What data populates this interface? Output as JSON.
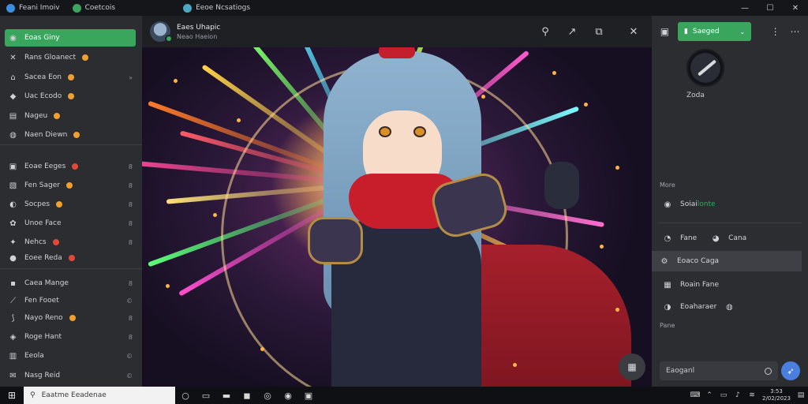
{
  "window": {
    "tabs": [
      {
        "label": "Feani Imoiv",
        "color": "#3b8fe0"
      },
      {
        "label": "Coetcois",
        "color": "#3aa55c"
      },
      {
        "label": "Eeoe Ncsatiogs",
        "color": "#4aa8c0"
      }
    ],
    "controls": {
      "minimize": "—",
      "maximize": "☐",
      "close": "✕"
    }
  },
  "sidebar": {
    "items": [
      {
        "label": "Eoas Giny",
        "icon": "app-icon",
        "glyph": "◉",
        "active": true,
        "badge": "",
        "count": ""
      },
      {
        "label": "Rans Gloanect",
        "icon": "close-icon",
        "glyph": "✕",
        "badge": "orange",
        "count": ""
      },
      {
        "label": "Sacea Eon",
        "icon": "home-icon",
        "glyph": "⌂",
        "badge": "orange",
        "count": "»"
      },
      {
        "label": "Uac Ecodo",
        "icon": "shield-icon",
        "glyph": "◆",
        "badge": "orange",
        "count": ""
      },
      {
        "label": "Nageu",
        "icon": "document-icon",
        "glyph": "▤",
        "badge": "orange",
        "count": ""
      },
      {
        "label": "Naen Diewn",
        "icon": "globe-icon",
        "glyph": "◍",
        "badge": "orange",
        "count": ""
      },
      {
        "label": "Eoae Eeges",
        "icon": "folder-icon",
        "glyph": "▣",
        "badge": "red",
        "count": "8"
      },
      {
        "label": "Fen Sager",
        "icon": "image-icon",
        "glyph": "▧",
        "badge": "orange",
        "count": "8"
      },
      {
        "label": "Socpes",
        "icon": "planet-icon",
        "glyph": "◐",
        "badge": "orange",
        "count": "8"
      },
      {
        "label": "Unoe Face",
        "icon": "puzzle-icon",
        "glyph": "✿",
        "badge": "",
        "count": "8"
      },
      {
        "label": "Nehcs",
        "icon": "star-icon",
        "glyph": "✦",
        "badge": "red",
        "count": "8"
      },
      {
        "label": "Eoee Reda",
        "icon": "coin-icon",
        "glyph": "●",
        "badge": "red",
        "count": ""
      },
      {
        "label": "Caea Mange",
        "icon": "gift-icon",
        "glyph": "▪",
        "badge": "",
        "count": "8"
      },
      {
        "label": "Fen Fooet",
        "icon": "chart-icon",
        "glyph": "⟋",
        "badge": "",
        "count": "©"
      },
      {
        "label": "Nayo Reno",
        "icon": "leaf-icon",
        "glyph": "⟆",
        "badge": "orange",
        "count": "8"
      },
      {
        "label": "Roge Hant",
        "icon": "gamepad-icon",
        "glyph": "◈",
        "badge": "",
        "count": "8"
      },
      {
        "label": "Eeola",
        "icon": "book-icon",
        "glyph": "▥",
        "badge": "",
        "count": "©"
      },
      {
        "label": "Nasg Reid",
        "icon": "mail-icon",
        "glyph": "✉",
        "badge": "",
        "count": "©"
      }
    ]
  },
  "viewer": {
    "title": "Eaes Uhapic",
    "subtitle": "Neao Haeion",
    "toolbar": [
      {
        "name": "pin-icon",
        "glyph": "⚲"
      },
      {
        "name": "share-icon",
        "glyph": "↗"
      },
      {
        "name": "copy-icon",
        "glyph": "⧉"
      },
      {
        "name": "close-viewer-icon",
        "glyph": "✕"
      }
    ],
    "float_button": "▦"
  },
  "rpanel": {
    "support_label": "Saeged",
    "menu_glyph": "⋮",
    "profile_name": "Zoda",
    "more_label": "More",
    "rate_label": "Pane",
    "items_top": [
      {
        "label": "Soiai",
        "accent": "lonte",
        "icon": "info-icon",
        "glyph": "◉"
      }
    ],
    "items": [
      {
        "label": "Fane",
        "label2": "Cana",
        "icon": "chat-icon",
        "glyph": "◔",
        "glyph2": "◕",
        "highlight": false
      },
      {
        "label": "Eoaco Caga",
        "icon": "settings-icon",
        "glyph": "⚙",
        "highlight": true
      },
      {
        "label": "Roain Fane",
        "icon": "grid-icon",
        "glyph": "▦",
        "highlight": false
      },
      {
        "label": "Eoaharaer",
        "icon": "person-icon",
        "glyph": "◑",
        "highlight": false
      }
    ],
    "input_value": "Eaoganl",
    "send_glyph": "➶"
  },
  "taskbar": {
    "start_glyph": "⊞",
    "search_placeholder": "Eaatme Eeadenae",
    "apps": [
      {
        "name": "cortana-icon",
        "glyph": "○"
      },
      {
        "name": "taskview-icon",
        "glyph": "▭"
      },
      {
        "name": "explorer-icon",
        "glyph": "▬"
      },
      {
        "name": "store-icon",
        "glyph": "◼"
      },
      {
        "name": "browser-icon",
        "glyph": "◎"
      },
      {
        "name": "edge-icon",
        "glyph": "◉"
      },
      {
        "name": "app-icon",
        "glyph": "▣"
      }
    ],
    "tray": [
      "⌨",
      "⌃",
      "▭",
      "♪",
      "≋"
    ],
    "clock_time": "3:53",
    "clock_date": "2/02/2023"
  }
}
